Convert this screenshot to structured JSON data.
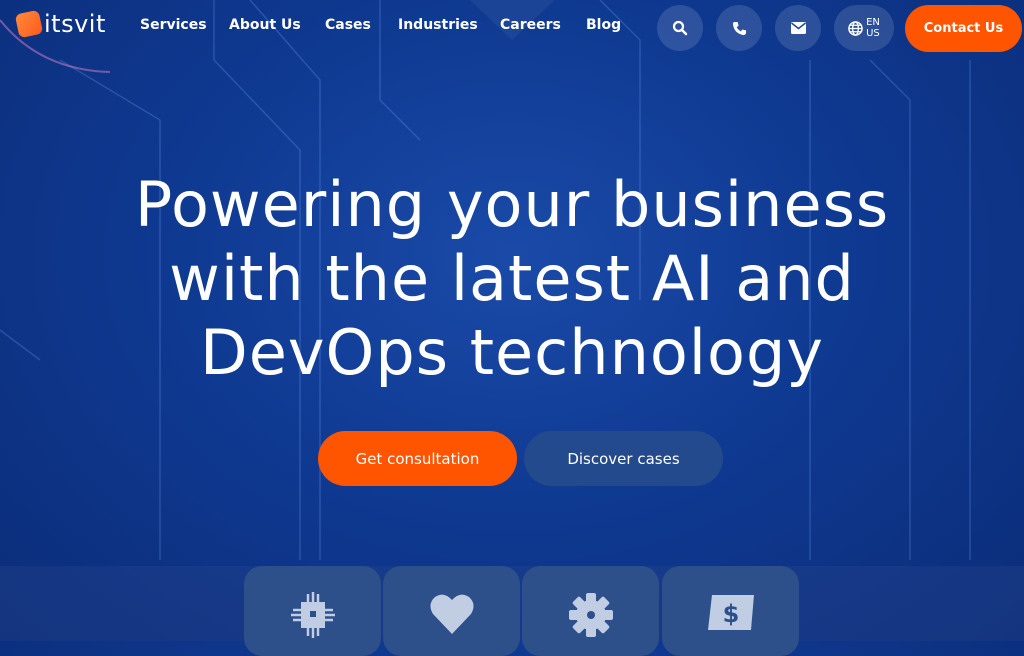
{
  "brand": {
    "name": "itsvit",
    "accent": "#ff5500",
    "background": "#0f3a92"
  },
  "nav": {
    "items": [
      "Services",
      "About Us",
      "Cases",
      "Industries",
      "Careers",
      "Blog"
    ],
    "icons": [
      "search-icon",
      "phone-icon",
      "mail-icon",
      "globe-icon"
    ],
    "lang": {
      "line1": "EN",
      "line2": "US"
    },
    "contact_label": "Contact Us"
  },
  "hero": {
    "title_lines": [
      "Powering your business",
      "with the latest AI and",
      "DevOps technology"
    ],
    "primary_button": "Get consultation",
    "secondary_button": "Discover cases"
  },
  "cards": {
    "icons": [
      "chip-icon",
      "heart-icon",
      "gear-icon",
      "dollar-icon"
    ]
  }
}
